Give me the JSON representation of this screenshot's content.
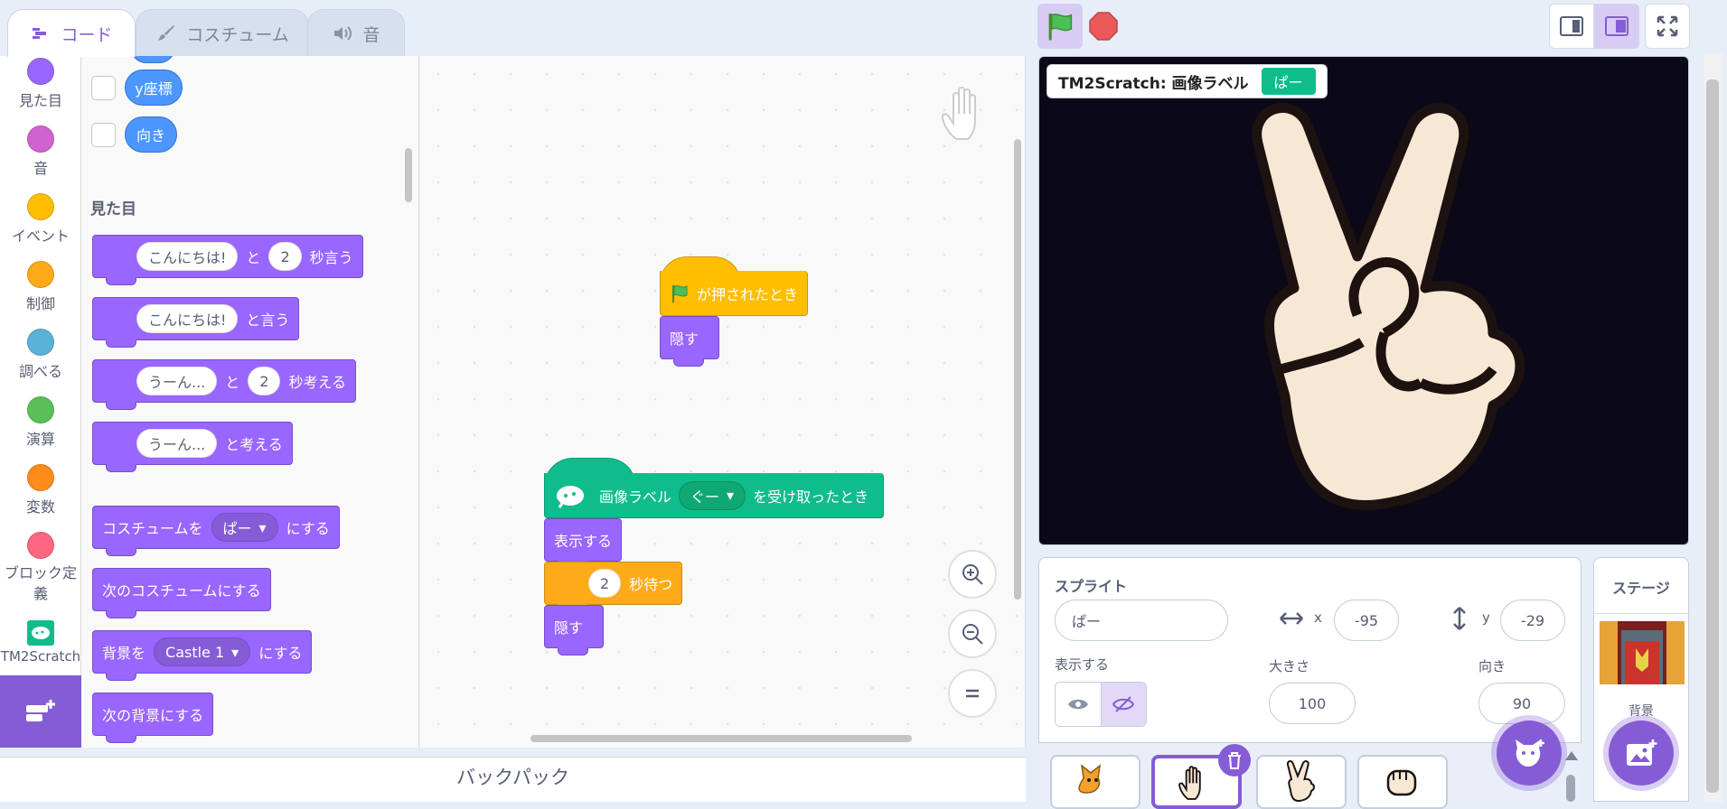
{
  "tabs": [
    {
      "label": "コード",
      "icon": "code-icon"
    },
    {
      "label": "コスチューム",
      "icon": "brush-icon"
    },
    {
      "label": "音",
      "icon": "speaker-icon"
    }
  ],
  "categories": [
    {
      "label": "見た目",
      "color": "#9966ff"
    },
    {
      "label": "音",
      "color": "#cf63cf"
    },
    {
      "label": "イベント",
      "color": "#ffbf00"
    },
    {
      "label": "制御",
      "color": "#ffab19"
    },
    {
      "label": "調べる",
      "color": "#5cb1d6"
    },
    {
      "label": "演算",
      "color": "#59c059"
    },
    {
      "label": "変数",
      "color": "#ff8c1a"
    },
    {
      "label": "ブロック定義",
      "color": "#ff6680"
    },
    {
      "label": "TM2Scratch",
      "color": "#0fbd8c"
    }
  ],
  "flyout": {
    "motion_reporters": [
      "y座標",
      "向き"
    ],
    "heading": "見た目",
    "say_for": {
      "input": "こんにちは!",
      "mid": "と",
      "secs": "2",
      "suffix": "秒言う"
    },
    "say": {
      "input": "こんにちは!",
      "suffix": "と言う"
    },
    "think_for": {
      "input": "うーん...",
      "mid": "と",
      "secs": "2",
      "suffix": "秒考える"
    },
    "think": {
      "input": "うーん...",
      "suffix": "と考える"
    },
    "switch_costume": {
      "prefix": "コスチュームを",
      "value": "ぱー",
      "suffix": "にする"
    },
    "next_costume": "次のコスチュームにする",
    "switch_backdrop": {
      "prefix": "背景を",
      "value": "Castle 1",
      "suffix": "にする"
    },
    "next_backdrop": "次の背景にする"
  },
  "scripts": {
    "flag_hat": "が押されたとき",
    "hide1": "隠す",
    "label_hat": {
      "prefix": "画像ラベル",
      "value": "ぐー",
      "suffix": "を受け取ったとき"
    },
    "show": "表示する",
    "wait": {
      "secs": "2",
      "suffix": "秒待つ"
    },
    "hide2": "隠す"
  },
  "backpack": "バックパック",
  "monitor": {
    "label": "TM2Scratch: 画像ラベル",
    "value": "ぱー"
  },
  "sprite_info": {
    "sprite_label": "スプライト",
    "name": "ぱー",
    "x_label": "x",
    "x": "-95",
    "y_label": "y",
    "y": "-29",
    "show_label": "表示する",
    "size_label": "大きさ",
    "size": "100",
    "direction_label": "向き",
    "direction": "90"
  },
  "stage_pane": {
    "title": "ステージ",
    "backdrop_label": "背景"
  },
  "colors": {
    "accent": "#855cd6",
    "looks": "#9966ff",
    "events": "#ffbf00",
    "control": "#ffab19",
    "extension": "#0fbd8c",
    "motion": "#4c97ff"
  }
}
